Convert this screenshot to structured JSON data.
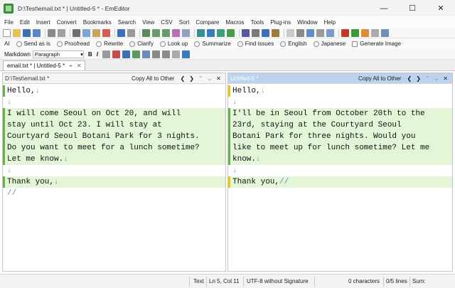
{
  "window": {
    "title": "D:\\Test\\email.txt * | Untitled-5 * - EmEditor"
  },
  "window_controls": {
    "minimize": "—",
    "maximize": "☐",
    "close": "✕"
  },
  "menu": [
    "File",
    "Edit",
    "Insert",
    "Convert",
    "Bookmarks",
    "Search",
    "View",
    "CSV",
    "Sort",
    "Compare",
    "Macros",
    "Tools",
    "Plug-ins",
    "Window",
    "Help"
  ],
  "ai_toolbar": {
    "prefix": "AI",
    "items": [
      "Send as is",
      "Proofread",
      "Rewrite",
      "Clarify",
      "Look up",
      "Summarize",
      "Find issues",
      "English",
      "Japanese",
      "Generate Image"
    ]
  },
  "format_bar": {
    "label": "Markdown",
    "paragraph_value": "Paragraph",
    "bold": "B",
    "italic": "I"
  },
  "tab": {
    "label": "email.txt * | Untitled-5 *"
  },
  "left_pane": {
    "path": "D:\\Test\\email.txt *",
    "copy_all": "Copy All to Other",
    "lines": [
      "Hello,",
      "",
      "I will come Seoul on Oct 20, and will",
      "stay until Oct 23. I will stay at",
      "Courtyard Seoul Botani Park for 3 nights.",
      "Do you want to meet for a lunch sometime?",
      "Let me know.",
      "",
      "Thank you,"
    ]
  },
  "right_pane": {
    "path": "Untitled-5 *",
    "copy_all": "Copy All to Other",
    "lines": [
      "Hello,",
      "",
      "I'll be in Seoul from October 20th to the",
      "23rd, staying at the Courtyard Seoul",
      "Botani Park for three nights. Would you",
      "like to meet up for lunch sometime? Let me",
      "know.",
      "",
      "Thank you,"
    ]
  },
  "status": {
    "mode": "Text",
    "position": "Ln 5, Col 11",
    "encoding": "UTF-8 without Signature",
    "chars": "0 characters",
    "lines": "0/5 lines",
    "sum": "Sum:"
  }
}
